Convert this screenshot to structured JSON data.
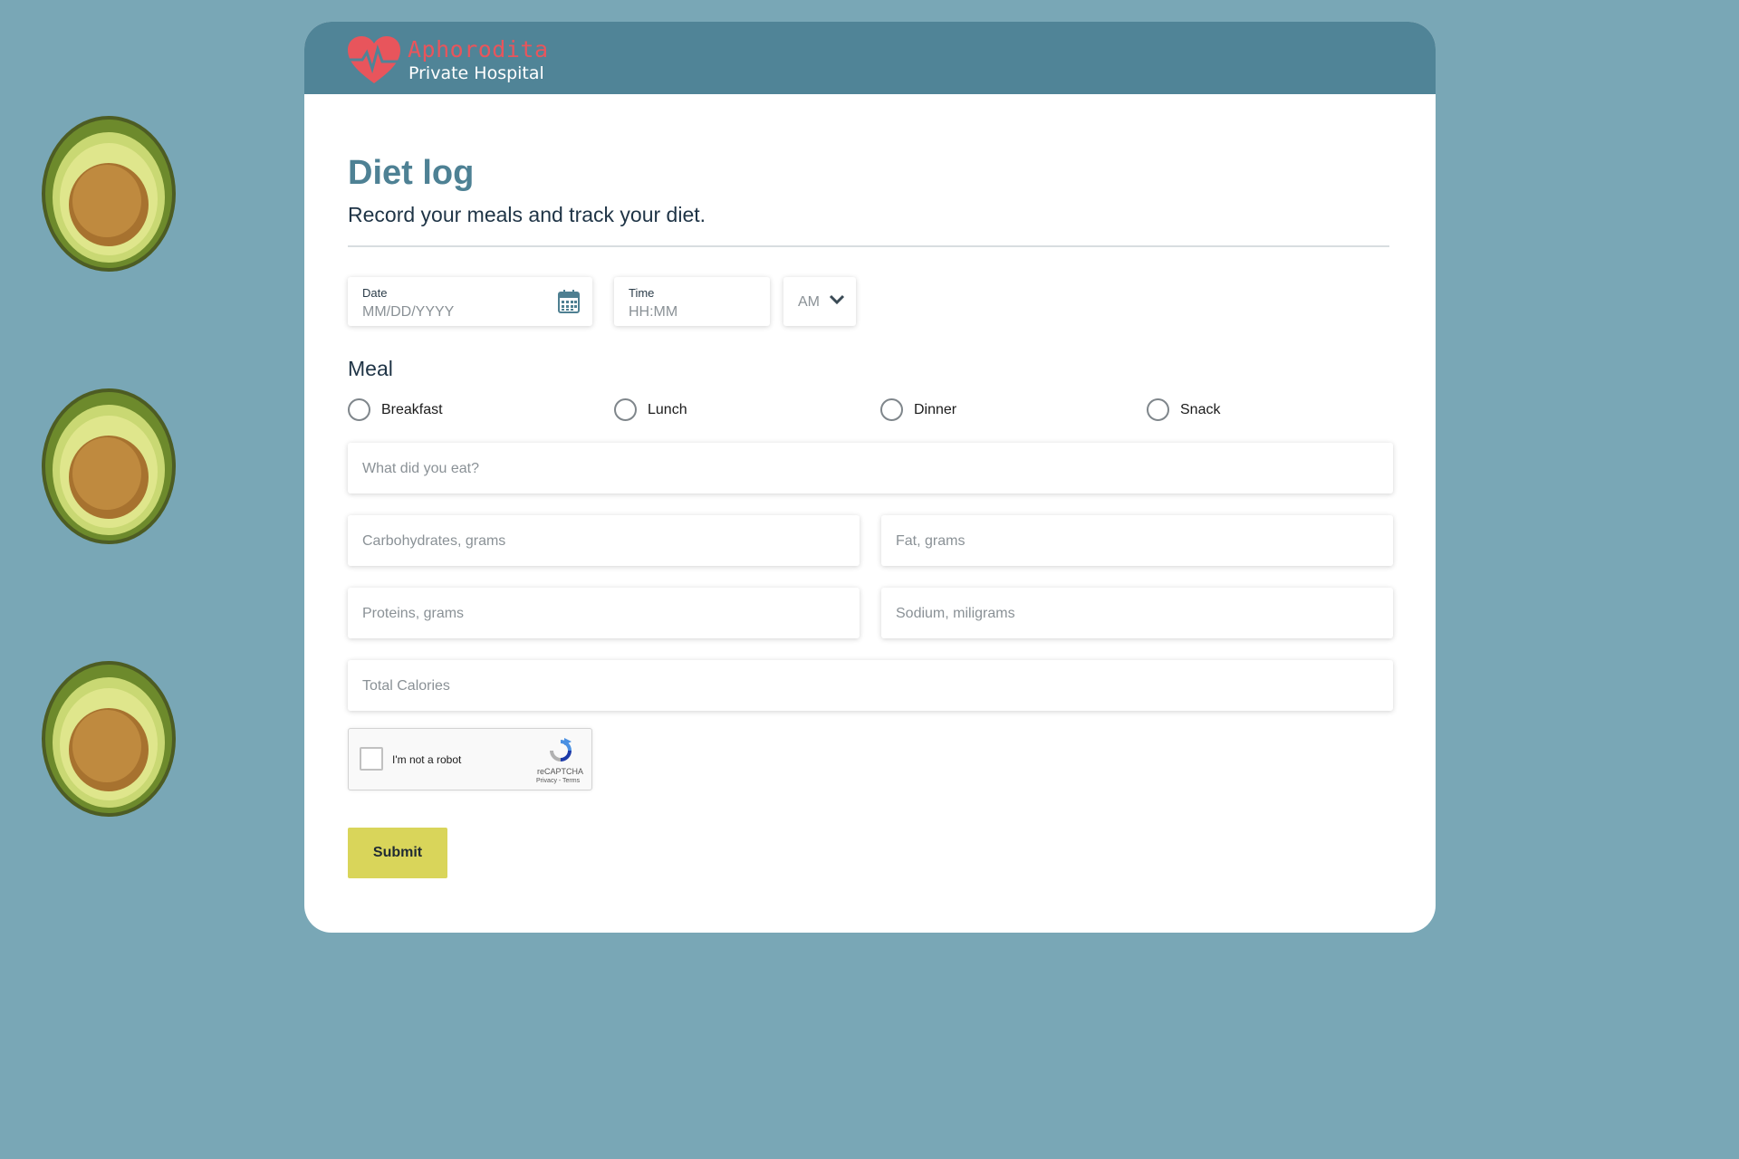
{
  "brand": {
    "name": "Aphorodita",
    "subtitle": "Private Hospital",
    "name_color": "#e8555c"
  },
  "page": {
    "title": "Diet log",
    "subtitle": "Record your meals and track your diet."
  },
  "date_field": {
    "label": "Date",
    "placeholder": "MM/DD/YYYY",
    "icon": "calendar-icon"
  },
  "time_field": {
    "label": "Time",
    "placeholder": "HH:MM"
  },
  "ampm_select": {
    "selected": "AM",
    "icon": "chevron-down-icon"
  },
  "meal": {
    "title": "Meal",
    "options": [
      "Breakfast",
      "Lunch",
      "Dinner",
      "Snack"
    ]
  },
  "inputs": {
    "food": "What did you eat?",
    "carbs": "Carbohydrates, grams",
    "fat": "Fat, grams",
    "proteins": "Proteins, grams",
    "sodium": "Sodium, miligrams",
    "calories": "Total Calories"
  },
  "captcha": {
    "label": "I'm not a robot",
    "brand": "reCAPTCHA",
    "terms": "Privacy - Terms"
  },
  "submit_label": "Submit",
  "colors": {
    "background": "#79a7b6",
    "header": "#508497",
    "title": "#4e8194",
    "submit": "#d9d55a"
  }
}
